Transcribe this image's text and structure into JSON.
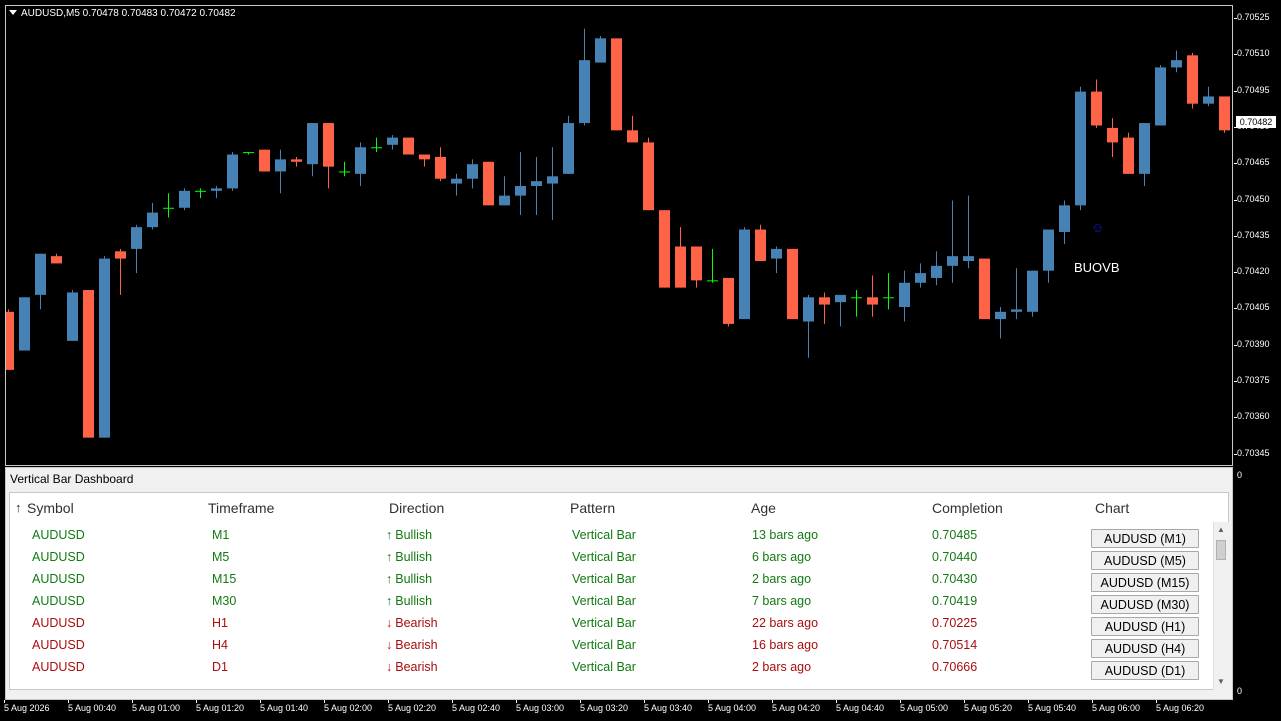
{
  "chart": {
    "header": "AUDUSD,M5  0.70478 0.70483 0.70472 0.70482",
    "current_price": "0.70482",
    "annotation_label": "BUOVB",
    "annotation_icon": "smiley-icon",
    "bull_color": "#4682b4",
    "bear_color": "#ff6347",
    "doji_color": "#00ff00",
    "price_labels": [
      "0.70525",
      "0.70510",
      "0.70495",
      "0.70480",
      "0.70465",
      "0.70450",
      "0.70435",
      "0.70420",
      "0.70405",
      "0.70390",
      "0.70375",
      "0.70360",
      "0.70345"
    ],
    "time_labels": [
      "5 Aug 2026",
      "5 Aug 00:40",
      "5 Aug 01:00",
      "5 Aug 01:20",
      "5 Aug 01:40",
      "5 Aug 02:00",
      "5 Aug 02:20",
      "5 Aug 02:40",
      "5 Aug 03:00",
      "5 Aug 03:20",
      "5 Aug 03:40",
      "5 Aug 04:00",
      "5 Aug 04:20",
      "5 Aug 04:40",
      "5 Aug 05:00",
      "5 Aug 05:20",
      "5 Aug 05:40",
      "5 Aug 06:00",
      "5 Aug 06:20"
    ],
    "indicator_scale_top": "0",
    "indicator_scale_bottom": "0",
    "candles": [
      {
        "o": 0.70404,
        "h": 0.70405,
        "l": 0.7038,
        "c": 0.7038
      },
      {
        "o": 0.70388,
        "h": 0.7041,
        "l": 0.70388,
        "c": 0.7041
      },
      {
        "o": 0.70411,
        "h": 0.70428,
        "l": 0.70405,
        "c": 0.70428
      },
      {
        "o": 0.70427,
        "h": 0.70428,
        "l": 0.70424,
        "c": 0.70424
      },
      {
        "o": 0.70392,
        "h": 0.70413,
        "l": 0.70392,
        "c": 0.70412
      },
      {
        "o": 0.70413,
        "h": 0.70413,
        "l": 0.70352,
        "c": 0.70352
      },
      {
        "o": 0.70352,
        "h": 0.70427,
        "l": 0.70352,
        "c": 0.70426
      },
      {
        "o": 0.70429,
        "h": 0.7043,
        "l": 0.70411,
        "c": 0.70426
      },
      {
        "o": 0.7043,
        "h": 0.7044,
        "l": 0.7042,
        "c": 0.70439
      },
      {
        "o": 0.70439,
        "h": 0.70449,
        "l": 0.70438,
        "c": 0.70445
      },
      {
        "o": 0.70447,
        "h": 0.70453,
        "l": 0.70443,
        "c": 0.70447
      },
      {
        "o": 0.70447,
        "h": 0.70455,
        "l": 0.70446,
        "c": 0.70454
      },
      {
        "o": 0.70454,
        "h": 0.70455,
        "l": 0.70451,
        "c": 0.70454
      },
      {
        "o": 0.70454,
        "h": 0.70456,
        "l": 0.70451,
        "c": 0.70455
      },
      {
        "o": 0.70455,
        "h": 0.7047,
        "l": 0.70454,
        "c": 0.70469
      },
      {
        "o": 0.7047,
        "h": 0.7047,
        "l": 0.70469,
        "c": 0.7047
      },
      {
        "o": 0.70471,
        "h": 0.70471,
        "l": 0.70462,
        "c": 0.70462
      },
      {
        "o": 0.70462,
        "h": 0.70471,
        "l": 0.70453,
        "c": 0.70467
      },
      {
        "o": 0.70467,
        "h": 0.70468,
        "l": 0.70464,
        "c": 0.70466
      },
      {
        "o": 0.70465,
        "h": 0.70482,
        "l": 0.7046,
        "c": 0.70482
      },
      {
        "o": 0.70482,
        "h": 0.70482,
        "l": 0.70455,
        "c": 0.70464
      },
      {
        "o": 0.70462,
        "h": 0.70466,
        "l": 0.7046,
        "c": 0.70462
      },
      {
        "o": 0.70461,
        "h": 0.70474,
        "l": 0.70456,
        "c": 0.70472
      },
      {
        "o": 0.70472,
        "h": 0.70476,
        "l": 0.7047,
        "c": 0.70472
      },
      {
        "o": 0.70473,
        "h": 0.70477,
        "l": 0.70471,
        "c": 0.70476
      },
      {
        "o": 0.70476,
        "h": 0.70476,
        "l": 0.70469,
        "c": 0.70469
      },
      {
        "o": 0.70469,
        "h": 0.70469,
        "l": 0.70464,
        "c": 0.70467
      },
      {
        "o": 0.70468,
        "h": 0.70472,
        "l": 0.70458,
        "c": 0.70459
      },
      {
        "o": 0.70457,
        "h": 0.70461,
        "l": 0.70452,
        "c": 0.70459
      },
      {
        "o": 0.70459,
        "h": 0.70467,
        "l": 0.70455,
        "c": 0.70465
      },
      {
        "o": 0.70466,
        "h": 0.70466,
        "l": 0.70448,
        "c": 0.70448
      },
      {
        "o": 0.70448,
        "h": 0.7046,
        "l": 0.70448,
        "c": 0.70452
      },
      {
        "o": 0.70452,
        "h": 0.7047,
        "l": 0.70444,
        "c": 0.70456
      },
      {
        "o": 0.70456,
        "h": 0.70468,
        "l": 0.70444,
        "c": 0.70458
      },
      {
        "o": 0.70457,
        "h": 0.70472,
        "l": 0.70442,
        "c": 0.7046
      },
      {
        "o": 0.70461,
        "h": 0.70485,
        "l": 0.70461,
        "c": 0.70482
      },
      {
        "o": 0.70482,
        "h": 0.70521,
        "l": 0.70481,
        "c": 0.70508
      },
      {
        "o": 0.70507,
        "h": 0.70518,
        "l": 0.70507,
        "c": 0.70517
      },
      {
        "o": 0.70517,
        "h": 0.70517,
        "l": 0.70479,
        "c": 0.70479
      },
      {
        "o": 0.70479,
        "h": 0.70485,
        "l": 0.70474,
        "c": 0.70474
      },
      {
        "o": 0.70474,
        "h": 0.70476,
        "l": 0.70446,
        "c": 0.70446
      },
      {
        "o": 0.70446,
        "h": 0.70446,
        "l": 0.70414,
        "c": 0.70414
      },
      {
        "o": 0.70431,
        "h": 0.70439,
        "l": 0.70414,
        "c": 0.70414
      },
      {
        "o": 0.70431,
        "h": 0.70431,
        "l": 0.70414,
        "c": 0.70417
      },
      {
        "o": 0.70417,
        "h": 0.7043,
        "l": 0.70416,
        "c": 0.70417
      },
      {
        "o": 0.70418,
        "h": 0.70418,
        "l": 0.70398,
        "c": 0.70399
      },
      {
        "o": 0.70401,
        "h": 0.70439,
        "l": 0.70401,
        "c": 0.70438
      },
      {
        "o": 0.70438,
        "h": 0.7044,
        "l": 0.70425,
        "c": 0.70425
      },
      {
        "o": 0.70426,
        "h": 0.70431,
        "l": 0.7042,
        "c": 0.7043
      },
      {
        "o": 0.7043,
        "h": 0.7043,
        "l": 0.70401,
        "c": 0.70401
      },
      {
        "o": 0.704,
        "h": 0.70411,
        "l": 0.70385,
        "c": 0.7041
      },
      {
        "o": 0.7041,
        "h": 0.70412,
        "l": 0.70399,
        "c": 0.70407
      },
      {
        "o": 0.70408,
        "h": 0.7041,
        "l": 0.70398,
        "c": 0.70411
      },
      {
        "o": 0.7041,
        "h": 0.70413,
        "l": 0.70402,
        "c": 0.7041
      },
      {
        "o": 0.7041,
        "h": 0.70419,
        "l": 0.70402,
        "c": 0.70407
      },
      {
        "o": 0.7041,
        "h": 0.7042,
        "l": 0.70405,
        "c": 0.7041
      },
      {
        "o": 0.70406,
        "h": 0.70421,
        "l": 0.704,
        "c": 0.70416
      },
      {
        "o": 0.70416,
        "h": 0.70424,
        "l": 0.70414,
        "c": 0.7042
      },
      {
        "o": 0.70418,
        "h": 0.70429,
        "l": 0.70415,
        "c": 0.70423
      },
      {
        "o": 0.70423,
        "h": 0.7045,
        "l": 0.70416,
        "c": 0.70427
      },
      {
        "o": 0.70425,
        "h": 0.70452,
        "l": 0.70422,
        "c": 0.70427
      },
      {
        "o": 0.70426,
        "h": 0.70426,
        "l": 0.70401,
        "c": 0.70401
      },
      {
        "o": 0.70401,
        "h": 0.70406,
        "l": 0.70393,
        "c": 0.70404
      },
      {
        "o": 0.70404,
        "h": 0.70422,
        "l": 0.70401,
        "c": 0.70405
      },
      {
        "o": 0.70404,
        "h": 0.70421,
        "l": 0.70402,
        "c": 0.70421
      },
      {
        "o": 0.70421,
        "h": 0.70434,
        "l": 0.70416,
        "c": 0.70438
      },
      {
        "o": 0.70437,
        "h": 0.7045,
        "l": 0.70432,
        "c": 0.70448
      },
      {
        "o": 0.70448,
        "h": 0.70497,
        "l": 0.70446,
        "c": 0.70495
      },
      {
        "o": 0.70495,
        "h": 0.705,
        "l": 0.7048,
        "c": 0.70481
      },
      {
        "o": 0.7048,
        "h": 0.70484,
        "l": 0.70468,
        "c": 0.70474
      },
      {
        "o": 0.70476,
        "h": 0.70478,
        "l": 0.70461,
        "c": 0.70461
      },
      {
        "o": 0.70461,
        "h": 0.7048,
        "l": 0.70456,
        "c": 0.70482
      },
      {
        "o": 0.70481,
        "h": 0.70506,
        "l": 0.70481,
        "c": 0.70505
      },
      {
        "o": 0.70505,
        "h": 0.70512,
        "l": 0.70503,
        "c": 0.70508
      },
      {
        "o": 0.7051,
        "h": 0.70511,
        "l": 0.70488,
        "c": 0.7049
      },
      {
        "o": 0.7049,
        "h": 0.70497,
        "l": 0.70489,
        "c": 0.70493
      },
      {
        "o": 0.70493,
        "h": 0.70493,
        "l": 0.70478,
        "c": 0.70479
      },
      {
        "o": 0.70478,
        "h": 0.70483,
        "l": 0.70472,
        "c": 0.70482
      }
    ]
  },
  "dashboard": {
    "title": "Vertical Bar Dashboard",
    "sort_icon": "up-arrow-icon",
    "headers": [
      "Symbol",
      "Timeframe",
      "Direction",
      "Pattern",
      "Age",
      "Completion",
      "Chart"
    ],
    "rows": [
      {
        "symbol": "AUDUSD",
        "timeframe": "M1",
        "direction": "Bullish",
        "dir_icon": "↑",
        "pattern": "Vertical Bar",
        "age": "13 bars ago",
        "completion": "0.70485",
        "chart_btn": "AUDUSD (M1)",
        "kind": "bull"
      },
      {
        "symbol": "AUDUSD",
        "timeframe": "M5",
        "direction": "Bullish",
        "dir_icon": "↑",
        "pattern": "Vertical Bar",
        "age": "6 bars ago",
        "completion": "0.70440",
        "chart_btn": "AUDUSD (M5)",
        "kind": "bull"
      },
      {
        "symbol": "AUDUSD",
        "timeframe": "M15",
        "direction": "Bullish",
        "dir_icon": "↑",
        "pattern": "Vertical Bar",
        "age": "2 bars ago",
        "completion": "0.70430",
        "chart_btn": "AUDUSD (M15)",
        "kind": "bull"
      },
      {
        "symbol": "AUDUSD",
        "timeframe": "M30",
        "direction": "Bullish",
        "dir_icon": "↑",
        "pattern": "Vertical Bar",
        "age": "7 bars ago",
        "completion": "0.70419",
        "chart_btn": "AUDUSD (M30)",
        "kind": "bull"
      },
      {
        "symbol": "AUDUSD",
        "timeframe": "H1",
        "direction": "Bearish",
        "dir_icon": "↓",
        "pattern": "Vertical Bar",
        "age": "22 bars ago",
        "completion": "0.70225",
        "chart_btn": "AUDUSD (H1)",
        "kind": "bear"
      },
      {
        "symbol": "AUDUSD",
        "timeframe": "H4",
        "direction": "Bearish",
        "dir_icon": "↓",
        "pattern": "Vertical Bar",
        "age": "16 bars ago",
        "completion": "0.70514",
        "chart_btn": "AUDUSD (H4)",
        "kind": "bear"
      },
      {
        "symbol": "AUDUSD",
        "timeframe": "D1",
        "direction": "Bearish",
        "dir_icon": "↓",
        "pattern": "Vertical Bar",
        "age": "2 bars ago",
        "completion": "0.70666",
        "chart_btn": "AUDUSD (D1)",
        "kind": "bear"
      }
    ],
    "scroll_up_icon": "▲",
    "scroll_down_icon": "▼"
  }
}
